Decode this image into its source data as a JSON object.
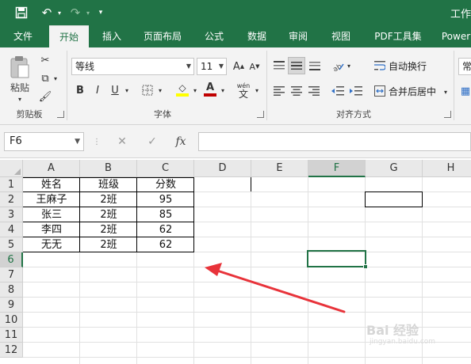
{
  "titlebar": {
    "title": "工作",
    "icons": [
      "save-icon",
      "undo-icon",
      "redo-icon",
      "customize-icon"
    ]
  },
  "ribbon_tabs": [
    "文件",
    "开始",
    "插入",
    "页面布局",
    "公式",
    "数据",
    "审阅",
    "视图",
    "PDF工具集",
    "Power"
  ],
  "active_tab": "开始",
  "clipboard": {
    "paste_label": "粘贴",
    "group_label": "剪贴板"
  },
  "font": {
    "family": "等线",
    "size": "11",
    "group_label": "字体",
    "bold": "B",
    "italic": "I",
    "underline": "U",
    "pinyin": "wén"
  },
  "alignment": {
    "wrap_text": "自动换行",
    "merge_center": "合并后居中",
    "group_label": "对齐方式"
  },
  "number_format": {
    "value": "常"
  },
  "formula_bar": {
    "name_box": "F6",
    "fx_label": "fx",
    "formula": ""
  },
  "columns": [
    "A",
    "B",
    "C",
    "D",
    "E",
    "F",
    "G",
    "H"
  ],
  "rows": [
    "1",
    "2",
    "3",
    "4",
    "5",
    "6",
    "7",
    "8",
    "9",
    "10",
    "11",
    "12"
  ],
  "selected_column": "F",
  "selected_row": "6",
  "table": {
    "headers": [
      "姓名",
      "班级",
      "分数"
    ],
    "rows": [
      [
        "王麻子",
        "2班",
        "95"
      ],
      [
        "张三",
        "2班",
        "85"
      ],
      [
        "李四",
        "2班",
        "62"
      ],
      [
        "无无",
        "2班",
        "62"
      ]
    ]
  },
  "watermark": {
    "brand": "Bai 经验",
    "url": "jingyan.baidu.com"
  },
  "colors": {
    "accent": "#217346",
    "annotation_arrow": "#e8333a",
    "font_color_swatch": "#c00000",
    "highlight_swatch": "#ffff00"
  }
}
